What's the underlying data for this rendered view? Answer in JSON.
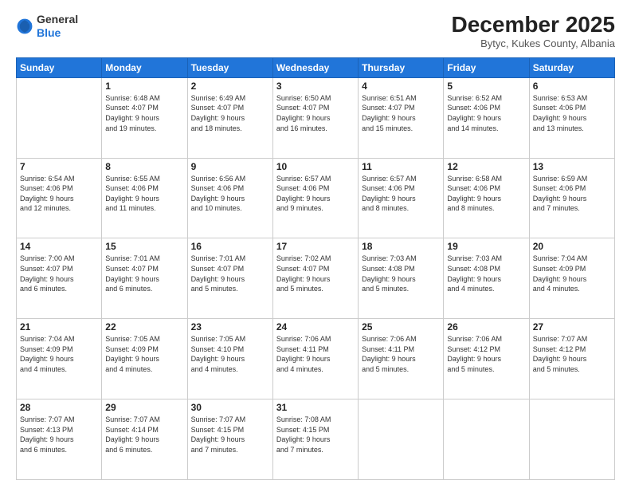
{
  "header": {
    "logo_general": "General",
    "logo_blue": "Blue",
    "month_title": "December 2025",
    "location": "Bytyc, Kukes County, Albania"
  },
  "days_of_week": [
    "Sunday",
    "Monday",
    "Tuesday",
    "Wednesday",
    "Thursday",
    "Friday",
    "Saturday"
  ],
  "weeks": [
    [
      {
        "day": "",
        "info": ""
      },
      {
        "day": "1",
        "info": "Sunrise: 6:48 AM\nSunset: 4:07 PM\nDaylight: 9 hours\nand 19 minutes."
      },
      {
        "day": "2",
        "info": "Sunrise: 6:49 AM\nSunset: 4:07 PM\nDaylight: 9 hours\nand 18 minutes."
      },
      {
        "day": "3",
        "info": "Sunrise: 6:50 AM\nSunset: 4:07 PM\nDaylight: 9 hours\nand 16 minutes."
      },
      {
        "day": "4",
        "info": "Sunrise: 6:51 AM\nSunset: 4:07 PM\nDaylight: 9 hours\nand 15 minutes."
      },
      {
        "day": "5",
        "info": "Sunrise: 6:52 AM\nSunset: 4:06 PM\nDaylight: 9 hours\nand 14 minutes."
      },
      {
        "day": "6",
        "info": "Sunrise: 6:53 AM\nSunset: 4:06 PM\nDaylight: 9 hours\nand 13 minutes."
      }
    ],
    [
      {
        "day": "7",
        "info": "Sunrise: 6:54 AM\nSunset: 4:06 PM\nDaylight: 9 hours\nand 12 minutes."
      },
      {
        "day": "8",
        "info": "Sunrise: 6:55 AM\nSunset: 4:06 PM\nDaylight: 9 hours\nand 11 minutes."
      },
      {
        "day": "9",
        "info": "Sunrise: 6:56 AM\nSunset: 4:06 PM\nDaylight: 9 hours\nand 10 minutes."
      },
      {
        "day": "10",
        "info": "Sunrise: 6:57 AM\nSunset: 4:06 PM\nDaylight: 9 hours\nand 9 minutes."
      },
      {
        "day": "11",
        "info": "Sunrise: 6:57 AM\nSunset: 4:06 PM\nDaylight: 9 hours\nand 8 minutes."
      },
      {
        "day": "12",
        "info": "Sunrise: 6:58 AM\nSunset: 4:06 PM\nDaylight: 9 hours\nand 8 minutes."
      },
      {
        "day": "13",
        "info": "Sunrise: 6:59 AM\nSunset: 4:06 PM\nDaylight: 9 hours\nand 7 minutes."
      }
    ],
    [
      {
        "day": "14",
        "info": "Sunrise: 7:00 AM\nSunset: 4:07 PM\nDaylight: 9 hours\nand 6 minutes."
      },
      {
        "day": "15",
        "info": "Sunrise: 7:01 AM\nSunset: 4:07 PM\nDaylight: 9 hours\nand 6 minutes."
      },
      {
        "day": "16",
        "info": "Sunrise: 7:01 AM\nSunset: 4:07 PM\nDaylight: 9 hours\nand 5 minutes."
      },
      {
        "day": "17",
        "info": "Sunrise: 7:02 AM\nSunset: 4:07 PM\nDaylight: 9 hours\nand 5 minutes."
      },
      {
        "day": "18",
        "info": "Sunrise: 7:03 AM\nSunset: 4:08 PM\nDaylight: 9 hours\nand 5 minutes."
      },
      {
        "day": "19",
        "info": "Sunrise: 7:03 AM\nSunset: 4:08 PM\nDaylight: 9 hours\nand 4 minutes."
      },
      {
        "day": "20",
        "info": "Sunrise: 7:04 AM\nSunset: 4:09 PM\nDaylight: 9 hours\nand 4 minutes."
      }
    ],
    [
      {
        "day": "21",
        "info": "Sunrise: 7:04 AM\nSunset: 4:09 PM\nDaylight: 9 hours\nand 4 minutes."
      },
      {
        "day": "22",
        "info": "Sunrise: 7:05 AM\nSunset: 4:09 PM\nDaylight: 9 hours\nand 4 minutes."
      },
      {
        "day": "23",
        "info": "Sunrise: 7:05 AM\nSunset: 4:10 PM\nDaylight: 9 hours\nand 4 minutes."
      },
      {
        "day": "24",
        "info": "Sunrise: 7:06 AM\nSunset: 4:11 PM\nDaylight: 9 hours\nand 4 minutes."
      },
      {
        "day": "25",
        "info": "Sunrise: 7:06 AM\nSunset: 4:11 PM\nDaylight: 9 hours\nand 5 minutes."
      },
      {
        "day": "26",
        "info": "Sunrise: 7:06 AM\nSunset: 4:12 PM\nDaylight: 9 hours\nand 5 minutes."
      },
      {
        "day": "27",
        "info": "Sunrise: 7:07 AM\nSunset: 4:12 PM\nDaylight: 9 hours\nand 5 minutes."
      }
    ],
    [
      {
        "day": "28",
        "info": "Sunrise: 7:07 AM\nSunset: 4:13 PM\nDaylight: 9 hours\nand 6 minutes."
      },
      {
        "day": "29",
        "info": "Sunrise: 7:07 AM\nSunset: 4:14 PM\nDaylight: 9 hours\nand 6 minutes."
      },
      {
        "day": "30",
        "info": "Sunrise: 7:07 AM\nSunset: 4:15 PM\nDaylight: 9 hours\nand 7 minutes."
      },
      {
        "day": "31",
        "info": "Sunrise: 7:08 AM\nSunset: 4:15 PM\nDaylight: 9 hours\nand 7 minutes."
      },
      {
        "day": "",
        "info": ""
      },
      {
        "day": "",
        "info": ""
      },
      {
        "day": "",
        "info": ""
      }
    ]
  ]
}
